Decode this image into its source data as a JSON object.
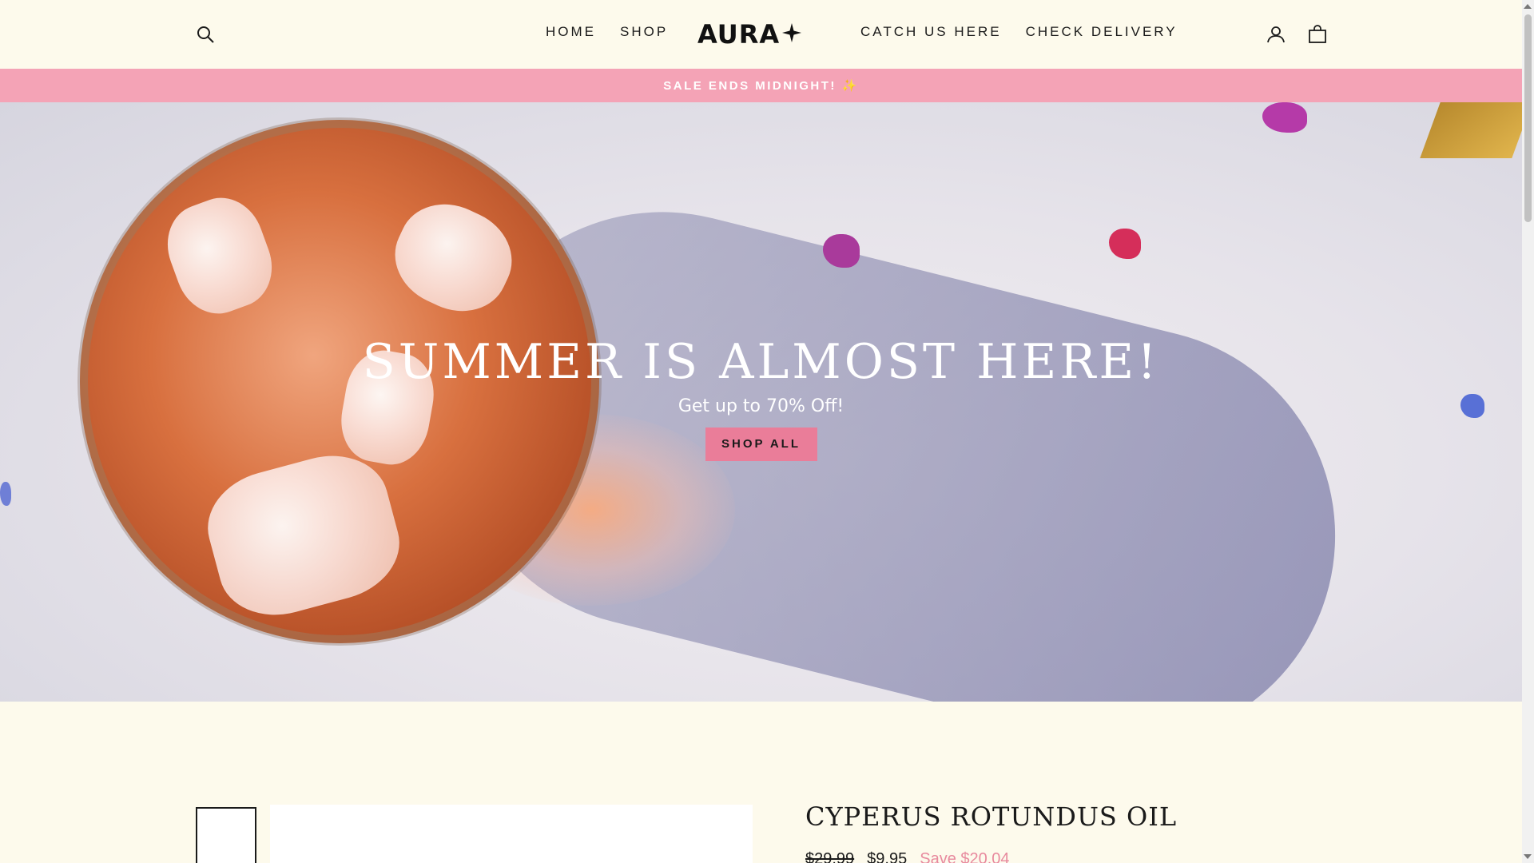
{
  "header": {
    "search_icon": "search-icon",
    "nav_left": [
      "HOME",
      "SHOP"
    ],
    "logo": "AURA",
    "logo_icon": "sparkle-icon",
    "nav_right": [
      "CATCH US HERE",
      "CHECK DELIVERY"
    ],
    "account_icon": "user-icon",
    "cart_icon": "shopping-bag-icon"
  },
  "announcement": {
    "text": "SALE ENDS MIDNIGHT! ✨",
    "background": "#f4a3b6"
  },
  "hero": {
    "title": "SUMMER IS ALMOST HERE!",
    "subtitle": "Get up to 70% Off!",
    "button": "SHOP ALL",
    "button_color": "#ea7d99"
  },
  "product": {
    "title": "CYPERUS ROTUNDUS OIL",
    "original_price": "$29.99",
    "sale_price": "$9.95",
    "savings": "Save $20.04",
    "savings_color": "#e88a9e"
  },
  "colors": {
    "background": "#fdfaec",
    "accent": "#f4a3b6"
  }
}
